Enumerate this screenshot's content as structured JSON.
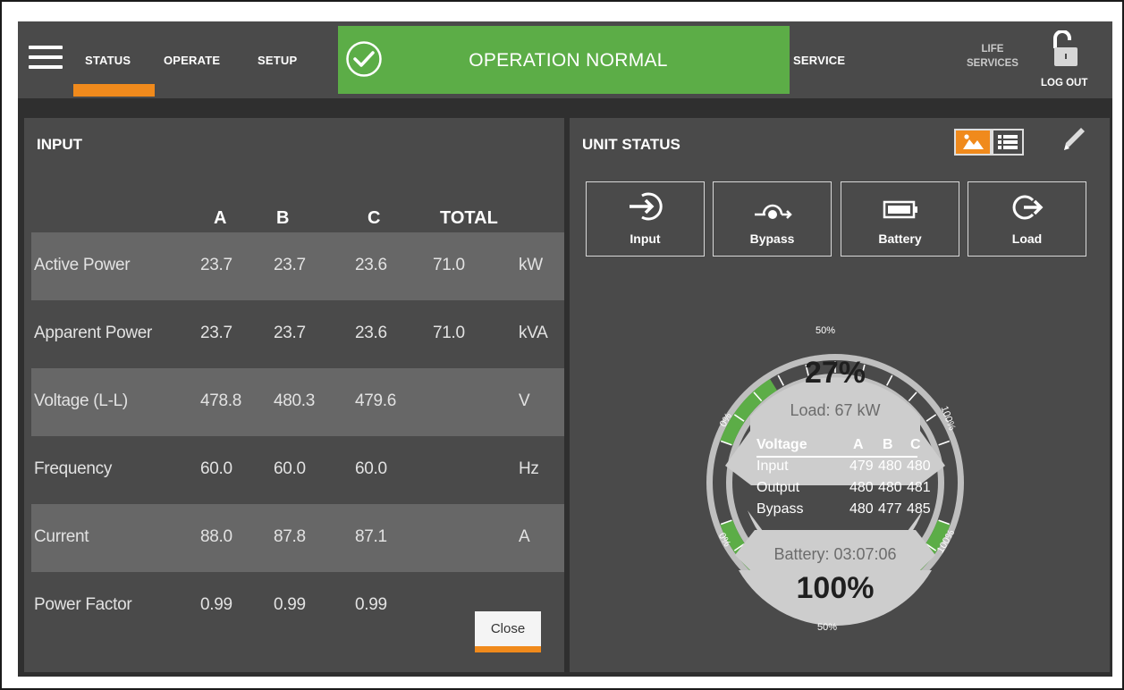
{
  "nav": {
    "status": "STATUS",
    "operate": "OPERATE",
    "setup": "SETUP",
    "service": "SERVICE",
    "life_services": "LIFE SERVICES",
    "logout": "LOG OUT",
    "active_tab": "STATUS",
    "accent": "#f08a1c"
  },
  "status_banner": {
    "text": "OPERATION NORMAL",
    "color": "#5cad47",
    "icon": "check-circle-icon"
  },
  "input": {
    "title": "INPUT",
    "columns": [
      "A",
      "B",
      "C",
      "TOTAL"
    ],
    "rows": [
      {
        "label": "Active Power",
        "a": "23.7",
        "b": "23.7",
        "c": "23.6",
        "total": "71.0",
        "unit": "kW"
      },
      {
        "label": "Apparent Power",
        "a": "23.7",
        "b": "23.7",
        "c": "23.6",
        "total": "71.0",
        "unit": "kVA"
      },
      {
        "label": "Voltage (L-L)",
        "a": "478.8",
        "b": "480.3",
        "c": "479.6",
        "total": "",
        "unit": "V"
      },
      {
        "label": "Frequency",
        "a": "60.0",
        "b": "60.0",
        "c": "60.0",
        "total": "",
        "unit": "Hz"
      },
      {
        "label": "Current",
        "a": "88.0",
        "b": "87.8",
        "c": "87.1",
        "total": "",
        "unit": "A"
      },
      {
        "label": "Power Factor",
        "a": "0.99",
        "b": "0.99",
        "c": "0.99",
        "total": "",
        "unit": ""
      }
    ],
    "close_label": "Close"
  },
  "unit_status": {
    "title": "UNIT STATUS",
    "view_icons": [
      "graph-view-icon",
      "list-view-icon",
      "pencil-icon"
    ],
    "buttons": [
      {
        "label": "Input",
        "icon": "input-arrow-icon"
      },
      {
        "label": "Bypass",
        "icon": "bypass-icon"
      },
      {
        "label": "Battery",
        "icon": "battery-icon"
      },
      {
        "label": "Load",
        "icon": "load-arrow-icon"
      }
    ],
    "gauge": {
      "load_percent": "27%",
      "load_fraction": 0.27,
      "load_text": "Load: 67 kW",
      "battery_time": "Battery: 03:07:06",
      "battery_percent": "100%",
      "battery_fraction": 1.0,
      "scale_top": [
        "0%",
        "50%",
        "100%"
      ],
      "scale_bottom": [
        "0%",
        "50%",
        "100%"
      ],
      "voltage_table": {
        "headers": [
          "Voltage",
          "A",
          "B",
          "C"
        ],
        "rows": [
          {
            "label": "Input",
            "a": "479",
            "b": "480",
            "c": "480"
          },
          {
            "label": "Output",
            "a": "480",
            "b": "480",
            "c": "481"
          },
          {
            "label": "Bypass",
            "a": "480",
            "b": "477",
            "c": "485"
          }
        ]
      }
    }
  }
}
